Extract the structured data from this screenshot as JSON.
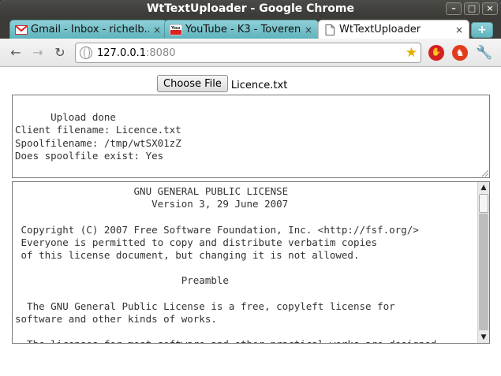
{
  "window": {
    "title": "WtTextUploader - Google Chrome"
  },
  "window_buttons": [
    "–",
    "□",
    "×"
  ],
  "tabs": [
    {
      "label": "Gmail - Inbox - richelb...",
      "icon": "gmail-icon",
      "state": "inactive"
    },
    {
      "label": "YouTube - K3 - Toveren",
      "icon": "youtube-icon",
      "state": "inactive"
    },
    {
      "label": "WtTextUploader",
      "icon": "page-icon",
      "state": "active"
    }
  ],
  "tab_close_symbol": "×",
  "favicons": {
    "youtube_text": "You"
  },
  "new_tab_symbol": "+",
  "address": {
    "host": "127.0.0.1",
    "port": ":8080"
  },
  "toolbar_icons": {
    "back": "←",
    "forward": "→",
    "reload": "↻",
    "star": "★",
    "stop": "✋",
    "shield": "♞",
    "wrench": "🔧"
  },
  "upload": {
    "button_label": "Choose File",
    "filename": "Licence.txt"
  },
  "status_text": "Upload done\nClient filename: Licence.txt\nSpoolfilename: /tmp/wtSX01zZ\nDoes spoolfile exist: Yes",
  "license_text": "                    GNU GENERAL PUBLIC LICENSE\n                       Version 3, 29 June 2007\n\n Copyright (C) 2007 Free Software Foundation, Inc. <http://fsf.org/>\n Everyone is permitted to copy and distribute verbatim copies\n of this license document, but changing it is not allowed.\n\n                            Preamble\n\n  The GNU General Public License is a free, copyleft license for\nsoftware and other kinds of works.\n\n  The licenses for most software and other practical works are designed",
  "scrollbar": {
    "up": "▲",
    "down": "▼"
  },
  "colors": {
    "tab_inactive": "#5fb3bd",
    "titlebar": "#3c3b37"
  }
}
